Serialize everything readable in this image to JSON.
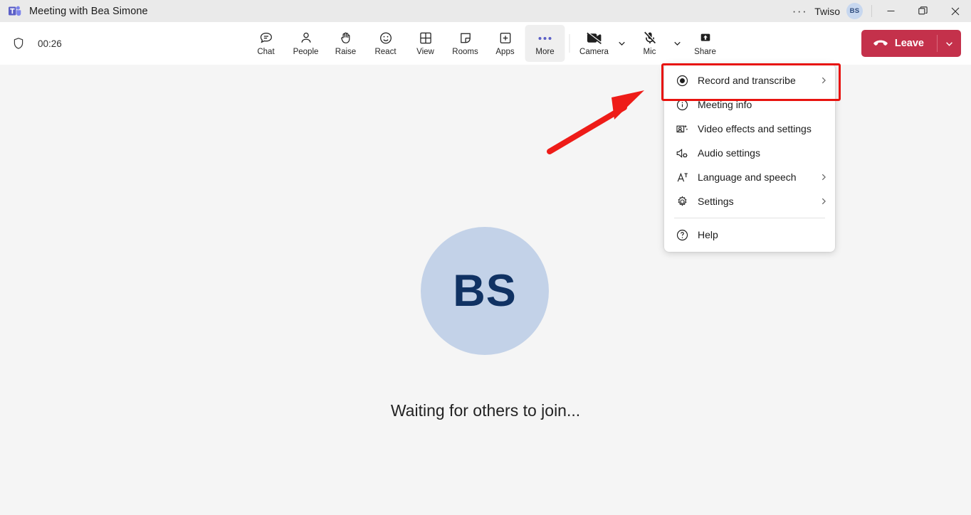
{
  "titlebar": {
    "app_icon": "teams-logo-icon",
    "title": "Meeting with Bea Simone",
    "overflow_label": "···",
    "user_name": "Twiso",
    "user_initials": "BS",
    "minimize_label": "—",
    "maximize_label": "❐",
    "close_label": "✕"
  },
  "toolbar": {
    "shield_icon": "shield-icon",
    "timer": "00:26",
    "buttons": [
      {
        "label": "Chat",
        "icon": "chat-icon"
      },
      {
        "label": "People",
        "icon": "people-icon"
      },
      {
        "label": "Raise",
        "icon": "raise-hand-icon"
      },
      {
        "label": "React",
        "icon": "react-smiley-icon"
      },
      {
        "label": "View",
        "icon": "view-grid-icon"
      },
      {
        "label": "Rooms",
        "icon": "breakout-rooms-icon"
      },
      {
        "label": "Apps",
        "icon": "apps-plus-icon"
      },
      {
        "label": "More",
        "icon": "more-dots-icon"
      }
    ],
    "camera": {
      "label": "Camera",
      "icon": "camera-off-icon"
    },
    "mic": {
      "label": "Mic",
      "icon": "mic-off-icon"
    },
    "share": {
      "label": "Share",
      "icon": "share-screen-icon"
    },
    "leave": {
      "label": "Leave",
      "icon": "hang-up-icon",
      "caret_icon": "chevron-down-icon"
    }
  },
  "stage": {
    "avatar_initials": "BS",
    "status_text": "Waiting for others to join..."
  },
  "menu": {
    "items": [
      {
        "label": "Record and transcribe",
        "icon": "record-circle-icon",
        "has_submenu": true
      },
      {
        "label": "Meeting info",
        "icon": "info-circle-icon",
        "has_submenu": false
      },
      {
        "label": "Video effects and settings",
        "icon": "video-effects-icon",
        "has_submenu": false
      },
      {
        "label": "Audio settings",
        "icon": "audio-speaker-icon",
        "has_submenu": false
      },
      {
        "label": "Language and speech",
        "icon": "language-a-icon",
        "has_submenu": true
      },
      {
        "label": "Settings",
        "icon": "gear-icon",
        "has_submenu": true
      }
    ],
    "help": {
      "label": "Help",
      "icon": "help-question-icon"
    }
  },
  "annotations": {
    "highlight_color": "#e8130f",
    "arrow_color": "#ee1c18"
  },
  "colors": {
    "leave_red": "#c4314b",
    "accent_purple": "#5b5fc7",
    "avatar_bg": "#c3d2e8",
    "avatar_fg": "#103263",
    "titlebar_bg": "#eaeaea",
    "stage_bg": "#f5f5f5"
  }
}
